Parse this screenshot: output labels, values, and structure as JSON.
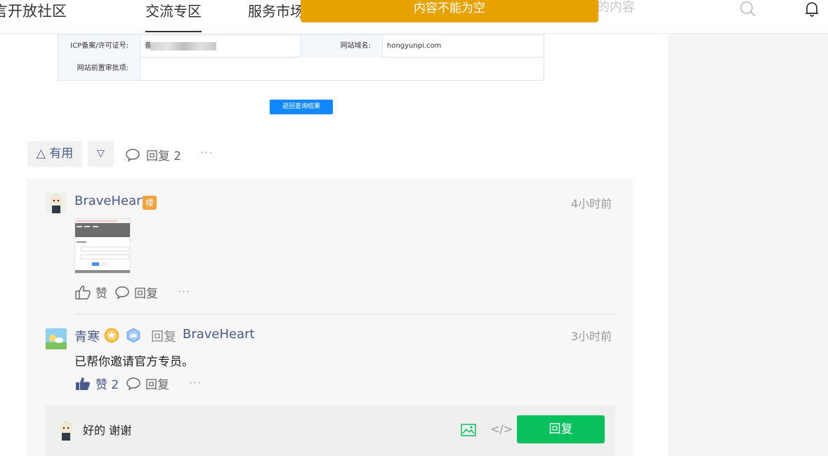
{
  "nav": {
    "brand": "言开放社区",
    "tabs": [
      {
        "label": "交流专区",
        "active": true
      },
      {
        "label": "服务市场"
      }
    ],
    "search_placeholder": "的内容"
  },
  "toast": {
    "message": "内容不能为空",
    "color": "#e8a200"
  },
  "icp_table": {
    "row1_label": "ICP备案/许可证号:",
    "row1_value_prefix": "备",
    "row1_label2": "网站域名:",
    "row1_value2": "hongyunpi.com",
    "row2_label": "网站前置审批项:",
    "back_button": "返回查询结果"
  },
  "post_actions": {
    "useful_label": "△ 有用",
    "down_label": "▽",
    "reply_label": "回复 2",
    "more": "···"
  },
  "comments": [
    {
      "user": "BraveHeart",
      "badge": "楼",
      "time": "4小时前",
      "like_label": "赞",
      "reply_label": "回复",
      "more": "···"
    },
    {
      "user": "青寒",
      "reply_word": "回复",
      "reply_to": "BraveHeart",
      "time": "3小时前",
      "text": "已帮你邀请官方专员。",
      "like_label": "赞 2",
      "reply_label": "回复",
      "more": "···"
    }
  ],
  "reply_box": {
    "input_value": "好的 谢谢",
    "code_icon": "</>",
    "submit_label": "回复"
  },
  "colors": {
    "accent_green": "#08c05c",
    "link_blue": "#4a5a8a"
  }
}
